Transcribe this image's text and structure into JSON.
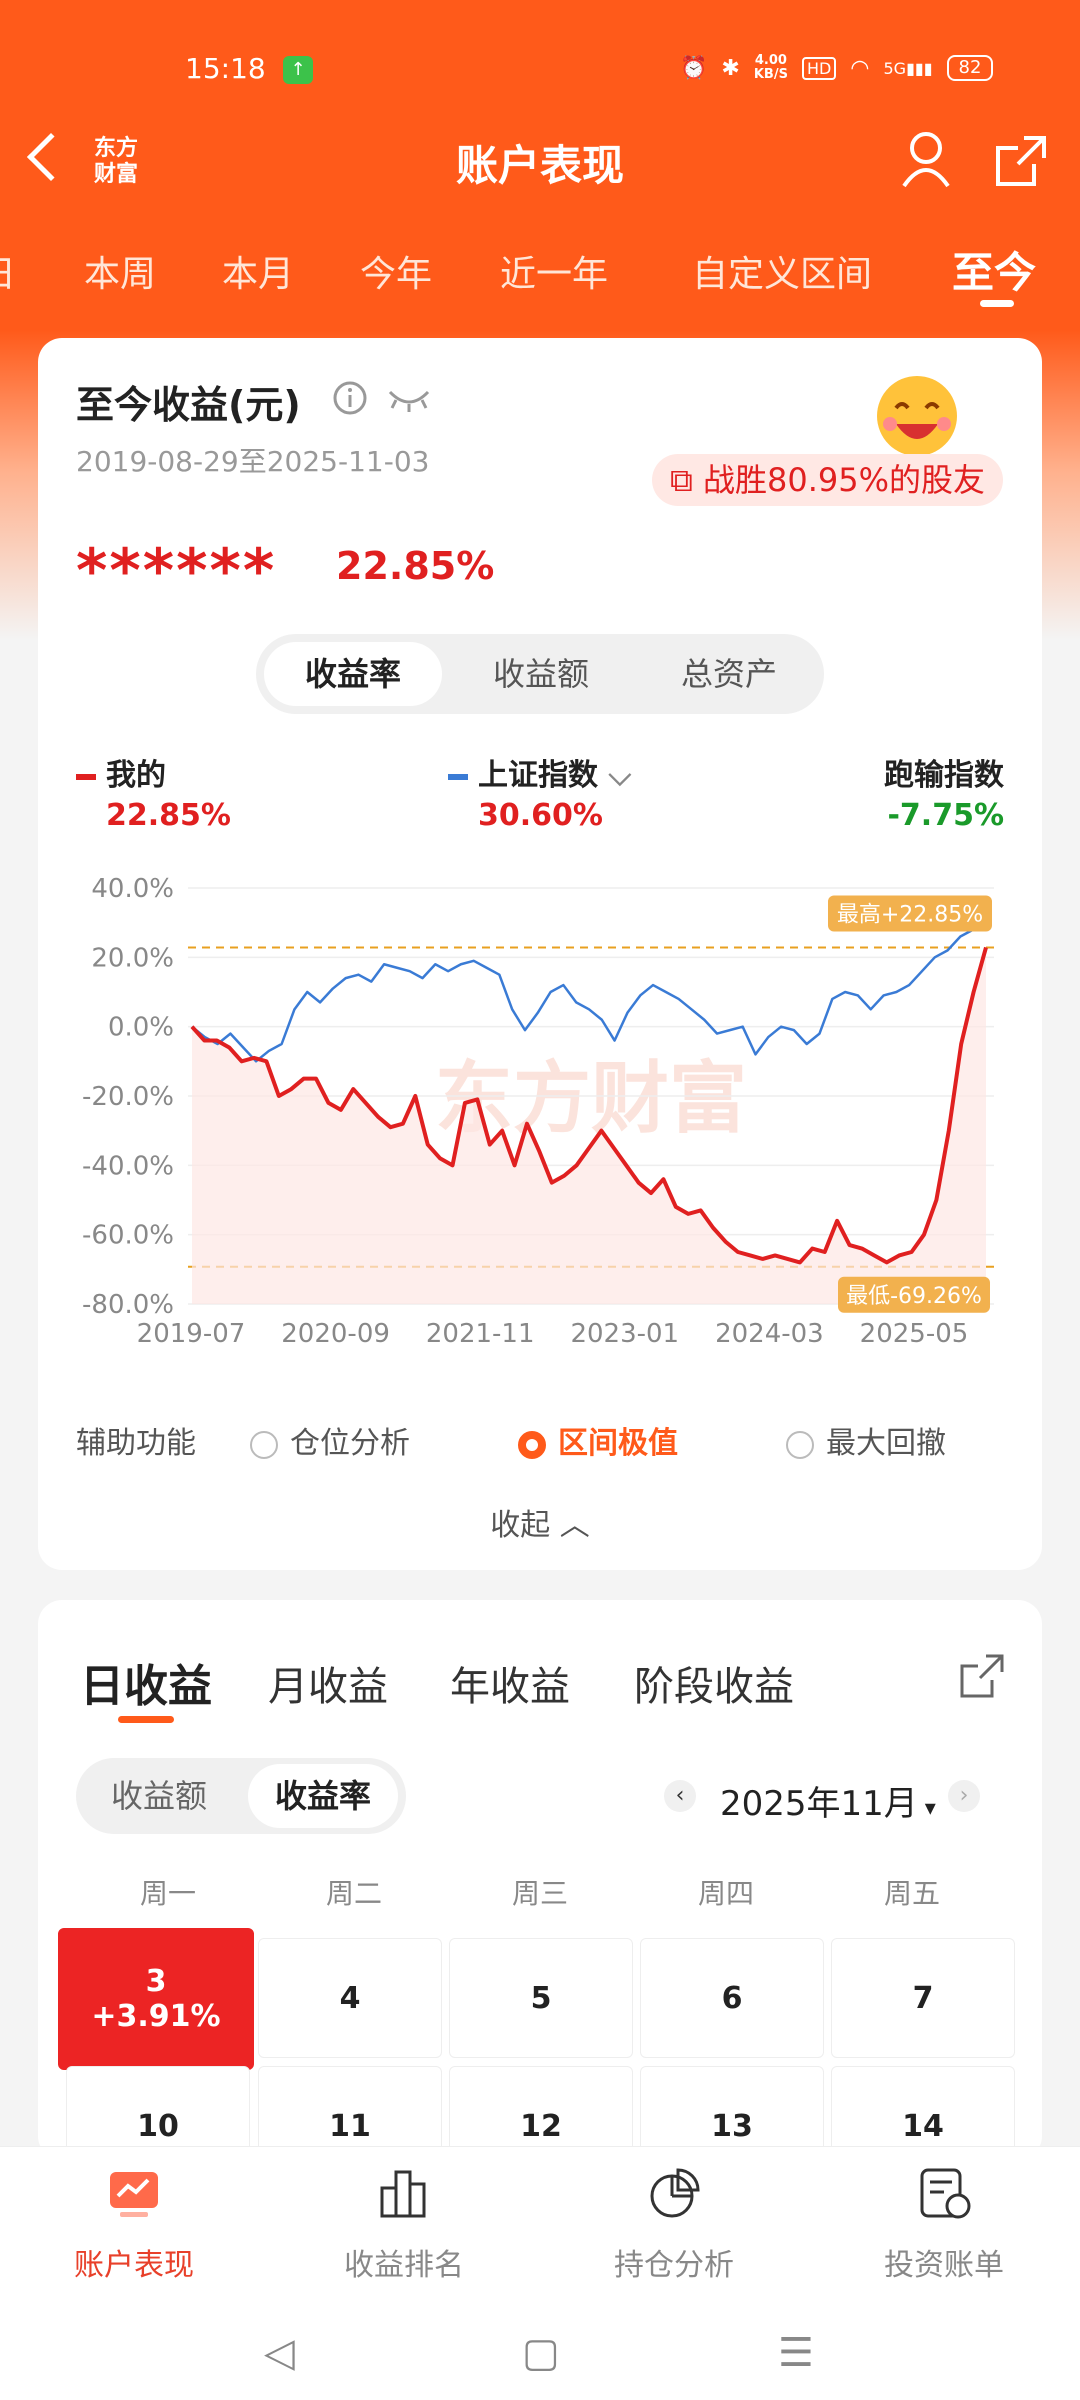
{
  "status_bar": {
    "time": "15:18",
    "speed_top": "4.00",
    "speed_unit": "KB/S",
    "net": "5G",
    "battery": "82"
  },
  "header": {
    "logo": "东方财富",
    "title": "账户表现"
  },
  "period_tabs": [
    {
      "label": "日"
    },
    {
      "label": "本周"
    },
    {
      "label": "本月"
    },
    {
      "label": "今年"
    },
    {
      "label": "近一年"
    },
    {
      "label": "自定义区间"
    },
    {
      "label": "至今"
    }
  ],
  "summary": {
    "title": "至今收益(元)",
    "date_range": "2019-08-29至2025-11-03",
    "beat_text": "战胜80.95%的股友",
    "masked_amount": "******",
    "return_rate": "22.85%"
  },
  "metric_toggle": [
    "收益率",
    "收益额",
    "总资产"
  ],
  "legend": [
    {
      "name": "我的",
      "value": "22.85%",
      "color": "#e02020"
    },
    {
      "name": "上证指数",
      "value": "30.60%",
      "color": "#3a7bd5"
    },
    {
      "name": "跑输指数",
      "value": "-7.75%"
    }
  ],
  "chart_data": {
    "type": "line",
    "ylim": [
      -80,
      40
    ],
    "yticks": [
      "40.0%",
      "20.0%",
      "0.0%",
      "-20.0%",
      "-40.0%",
      "-60.0%",
      "-80.0%"
    ],
    "xticks": [
      "2019-07",
      "2020-09",
      "2021-11",
      "2023-01",
      "2024-03",
      "2025-05"
    ],
    "series": [
      {
        "name": "我的",
        "color": "#e02020",
        "values": [
          0,
          -4,
          -4,
          -6,
          -10,
          -9,
          -10,
          -20,
          -18,
          -15,
          -15,
          -22,
          -24,
          -18,
          -22,
          -26,
          -29,
          -28,
          -20,
          -34,
          -38,
          -40,
          -22,
          -21,
          -34,
          -30,
          -40,
          -28,
          -36,
          -45,
          -43,
          -40,
          -35,
          -30,
          -35,
          -40,
          -45,
          -48,
          -44,
          -52,
          -54,
          -53,
          -58,
          -62,
          -65,
          -66,
          -67,
          -66,
          -67,
          -68,
          -64,
          -65,
          -56,
          -63,
          -64,
          -66,
          -68,
          -66,
          -65,
          -60,
          -50,
          -30,
          -5,
          10,
          22.85
        ]
      },
      {
        "name": "上证指数",
        "color": "#3a7bd5",
        "values": [
          0,
          -3,
          -5,
          -2,
          -6,
          -10,
          -7,
          -5,
          5,
          10,
          7,
          11,
          14,
          15,
          13,
          18,
          17,
          16,
          14,
          18,
          16,
          18,
          19,
          17,
          15,
          5,
          -1,
          4,
          10,
          12,
          7,
          5,
          2,
          -4,
          4,
          9,
          12,
          10,
          8,
          5,
          2,
          -2,
          -1,
          0,
          -8,
          -3,
          0,
          -1,
          -5,
          -2,
          8,
          10,
          9,
          5,
          9,
          10,
          12,
          16,
          20,
          22,
          26,
          28,
          30.6
        ]
      }
    ],
    "annotations": {
      "max": "最高+22.85%",
      "min": "最低-69.26%"
    },
    "watermark": "东方财富"
  },
  "aux": {
    "label": "辅助功能",
    "options": [
      "仓位分析",
      "区间极值",
      "最大回撤"
    ],
    "collapse": "收起"
  },
  "returns": {
    "tabs": [
      "日收益",
      "月收益",
      "年收益",
      "阶段收益"
    ],
    "toggle": [
      "收益额",
      "收益率"
    ],
    "month": "2025年11月",
    "weekdays": [
      "周一",
      "周二",
      "周三",
      "周四",
      "周五"
    ],
    "day3": "3",
    "day3_value": "+3.91%",
    "days_row1": [
      "4",
      "5",
      "6",
      "7"
    ],
    "days_row2": [
      "10",
      "11",
      "12",
      "13",
      "14"
    ]
  },
  "bottom_nav": [
    {
      "label": "账户表现"
    },
    {
      "label": "收益排名"
    },
    {
      "label": "持仓分析"
    },
    {
      "label": "投资账单"
    }
  ]
}
